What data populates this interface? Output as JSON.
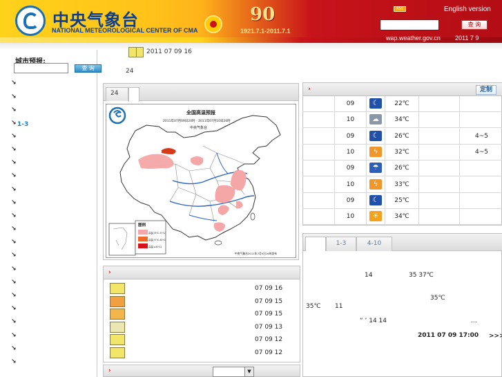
{
  "header": {
    "cn_title": "中央气象台",
    "en_title": "NATIONAL METEOROLOGICAL CENTER OF CMA",
    "anniversary_number": "90",
    "anniversary_dates": "1921.7.1-2011.7.1",
    "rss_label": "RSS",
    "english_link": "English version",
    "query_button": "查 询",
    "wap_link": "wap.weather.gov.cn",
    "date": "2011 7 9"
  },
  "sidebar": {
    "city_label": "城市预报:",
    "query_button": "查 询",
    "active_item_label": "1-3",
    "arrow_glyph": "↘"
  },
  "middle": {
    "thumb_date": "2011 07 09 16",
    "label_24": "24"
  },
  "map_panel": {
    "tab_label": "24",
    "map_title": "全国高温预报",
    "map_subtitle": "2011年07月09日20时 - 2011年07月10日20时",
    "map_issuer": "中央气象台",
    "legend_title": "图例",
    "legend_items": [
      "高温(35℃-37℃)",
      "高温(37℃-40℃)",
      "高温(≥40℃)"
    ],
    "footer_text": "中央气象台2011年7月9日16时发布"
  },
  "forecast_table": {
    "custom_button": "定制",
    "rows": [
      {
        "day": "09",
        "icon": "moon-icon",
        "temp": "22℃",
        "wind": ""
      },
      {
        "day": "10",
        "icon": "cloudy-icon",
        "temp": "34℃",
        "wind": ""
      },
      {
        "day": "09",
        "icon": "moon-icon",
        "temp": "26℃",
        "wind": "4~5"
      },
      {
        "day": "10",
        "icon": "thunderstorm-icon",
        "temp": "32℃",
        "wind": "4~5"
      },
      {
        "day": "09",
        "icon": "rain-night-icon",
        "temp": "26℃",
        "wind": ""
      },
      {
        "day": "10",
        "icon": "thunderstorm-icon",
        "temp": "33℃",
        "wind": ""
      },
      {
        "day": "09",
        "icon": "moon-icon",
        "temp": "25℃",
        "wind": ""
      },
      {
        "day": "10",
        "icon": "sunny-cloud-icon",
        "temp": "34℃",
        "wind": ""
      }
    ]
  },
  "news_panel": {
    "tabs": [
      "",
      "1-3",
      "4-10"
    ],
    "line1_a": "14",
    "line1_b": "35 37℃",
    "line2": "35℃",
    "line3_a": "35℃",
    "line3_b": "11",
    "line4_a": "“  ’  14    14",
    "line4_b": "...",
    "footer_date": "2011  07  09   17:00",
    "more_link": ">>>"
  },
  "product_list": {
    "items": [
      {
        "date": "07 09 16"
      },
      {
        "date": "07 09 15"
      },
      {
        "date": "07 09 15"
      },
      {
        "date": "07 09 13"
      },
      {
        "date": "07 09 12"
      },
      {
        "date": "07 09 12"
      }
    ]
  }
}
